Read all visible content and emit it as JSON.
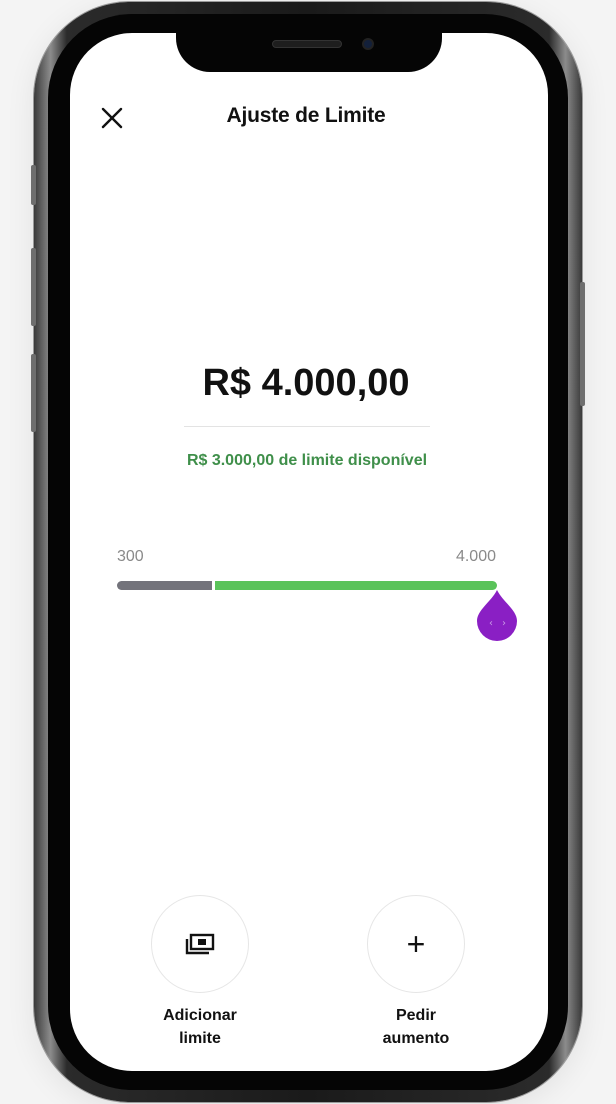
{
  "header": {
    "title": "Ajuste de Limite",
    "close_icon": "close-icon"
  },
  "limit": {
    "amount": "R$ 4.000,00",
    "available_text": "R$ 3.000,00 de limite disponível"
  },
  "slider": {
    "min_label": "300",
    "max_label": "4.000",
    "used_fraction": 0.25,
    "value_fraction": 1.0,
    "colors": {
      "used": "#73737b",
      "available": "#5ac35a",
      "handle": "#8a1fc4"
    }
  },
  "actions": [
    {
      "label_line1": "Adicionar",
      "label_line2": "limite",
      "icon": "money-icon"
    },
    {
      "label_line1": "Pedir",
      "label_line2": "aumento",
      "icon": "plus-icon",
      "glyph": "+"
    }
  ]
}
